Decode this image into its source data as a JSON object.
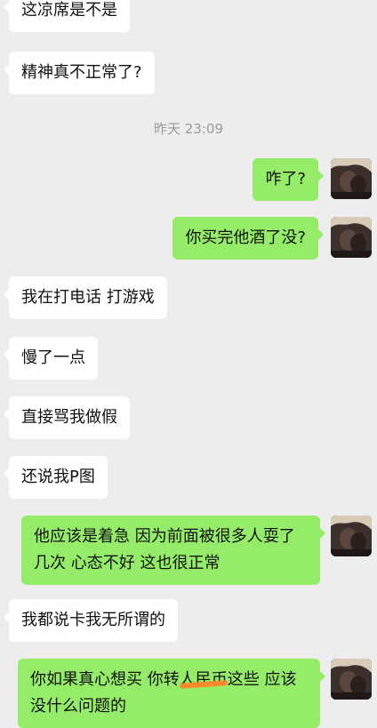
{
  "timestamp": "昨天 23:09",
  "messages": [
    {
      "side": "in",
      "text": "这凉席是不是"
    },
    {
      "side": "in",
      "text": "精神真不正常了?"
    },
    {
      "side": "out",
      "text": "咋了?"
    },
    {
      "side": "out",
      "text": "你买完他酒了没?"
    },
    {
      "side": "in",
      "text": "我在打电话 打游戏"
    },
    {
      "side": "in",
      "text": "慢了一点"
    },
    {
      "side": "in",
      "text": "直接骂我做假"
    },
    {
      "side": "in",
      "text": "还说我P图"
    },
    {
      "side": "out",
      "text": "他应该是着急 因为前面被很多人耍了几次 心态不好 这也很正常"
    },
    {
      "side": "in",
      "text": "我都说卡我无所谓的"
    },
    {
      "side": "out",
      "text_part1": "你如果真心想买 你转",
      "text_scribbled": "人民币",
      "text_part2": "这些 应该没什么问题的"
    }
  ],
  "colors": {
    "background": "#ededed",
    "incoming_bubble": "#ffffff",
    "outgoing_bubble": "#95ec69",
    "scribble": "#ff8a2a",
    "timestamp": "#9a9a9a"
  },
  "icons": {
    "avatar": "user-avatar-photo"
  }
}
